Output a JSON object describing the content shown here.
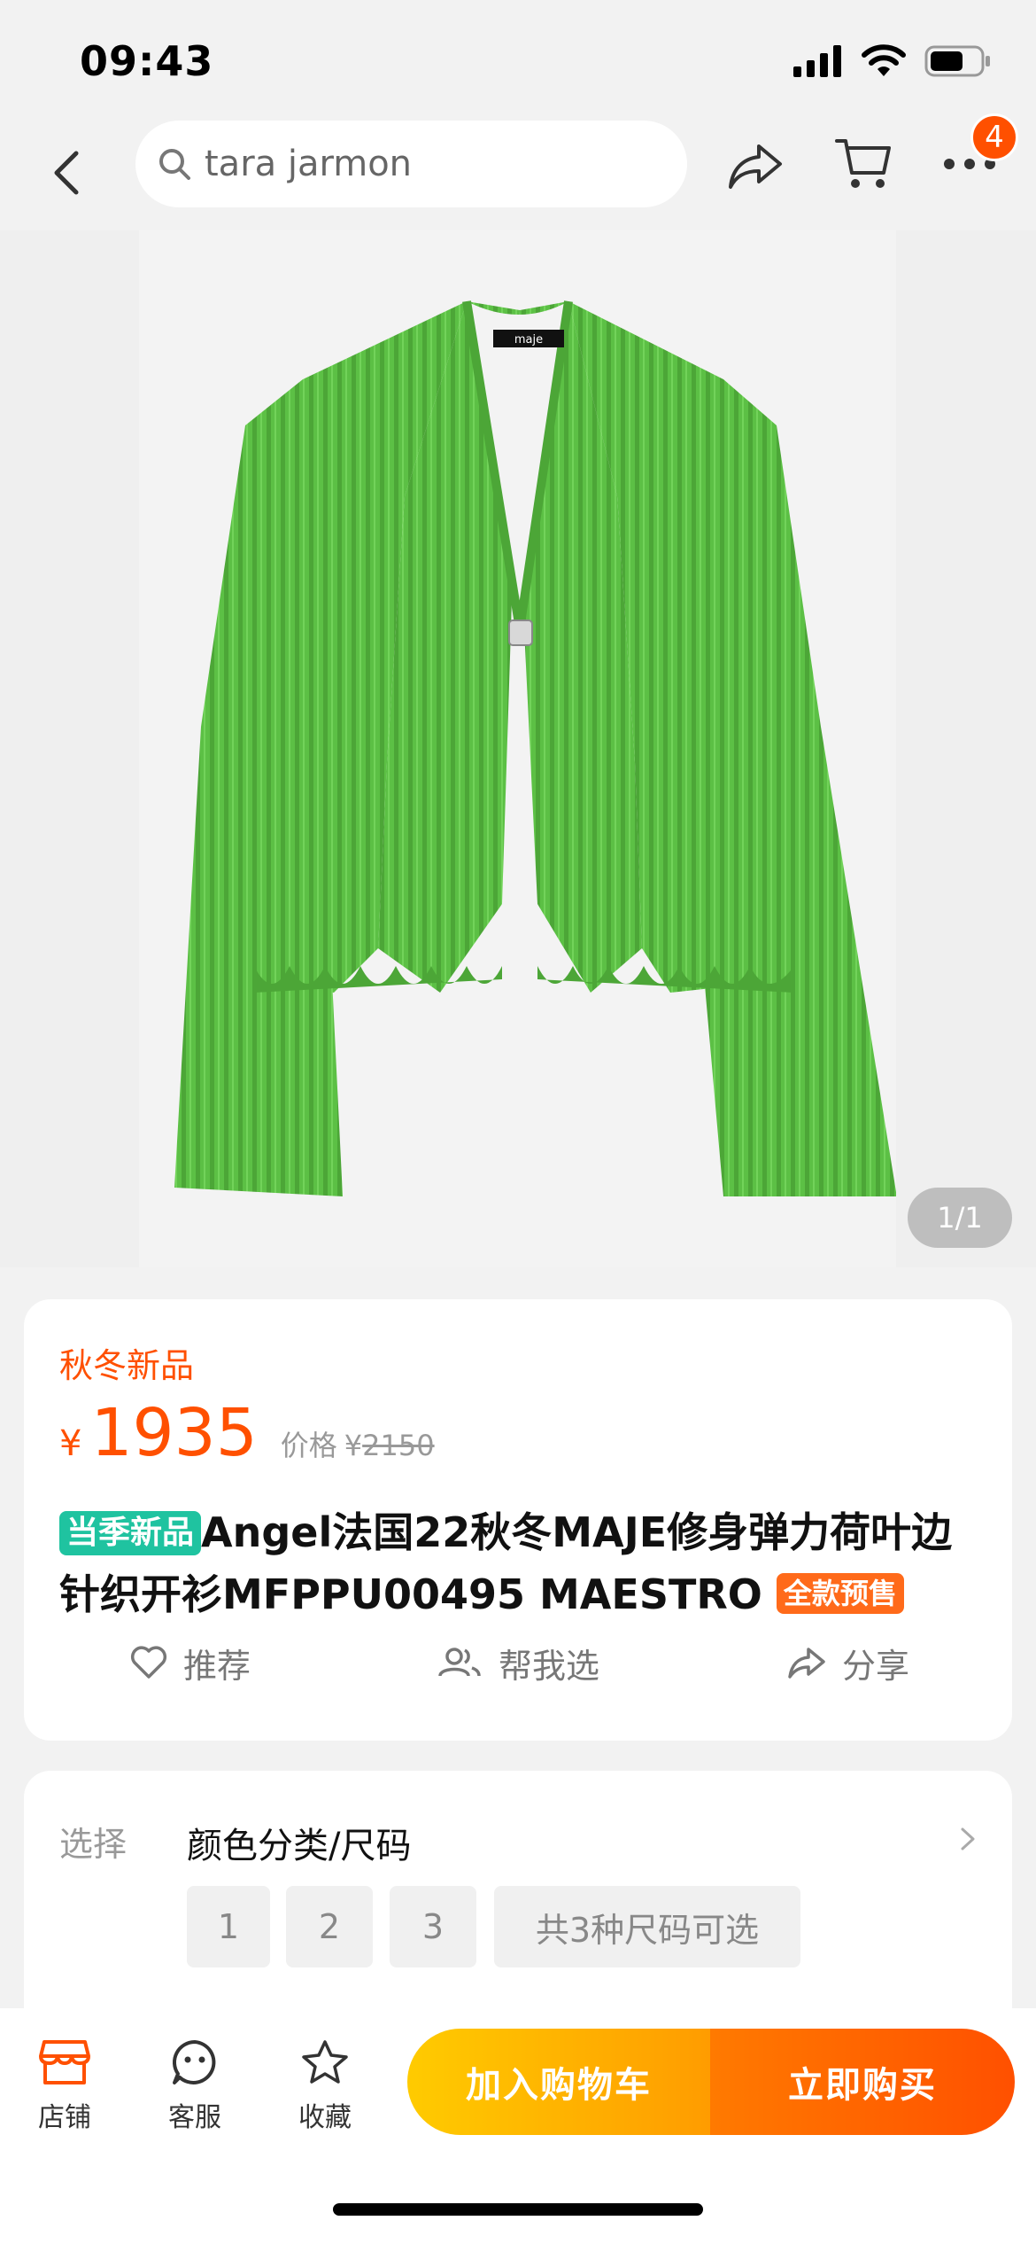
{
  "status_bar": {
    "time": "09:43"
  },
  "nav": {
    "search_text": "tara jarmon",
    "badge_count": "4"
  },
  "gallery": {
    "page_indicator": "1/1",
    "brand_label": "maje"
  },
  "product": {
    "season_tag": "秋冬新品",
    "price_symbol": "¥",
    "price": "1935",
    "original_label": "价格",
    "original_symbol": "¥",
    "original_price": "2150",
    "new_badge": "当季新品",
    "title": "Angel法国22秋冬MAJE修身弹力荷叶边针织开衫MFPPU00495 MAESTRO",
    "presale_badge": "全款预售",
    "actions": {
      "recommend": "推荐",
      "help_choose": "帮我选",
      "share": "分享"
    }
  },
  "select": {
    "label": "选择",
    "value": "颜色分类/尺码",
    "sizes": [
      "1",
      "2",
      "3"
    ],
    "summary": "共3种尺码可选"
  },
  "bottom_bar": {
    "store": "店铺",
    "service": "客服",
    "favorite": "收藏",
    "add_to_cart": "加入购物车",
    "buy_now": "立即购买"
  },
  "colors": {
    "accent": "#ff5000",
    "new_badge": "#1fc3a0",
    "garment": "#5cc045"
  }
}
